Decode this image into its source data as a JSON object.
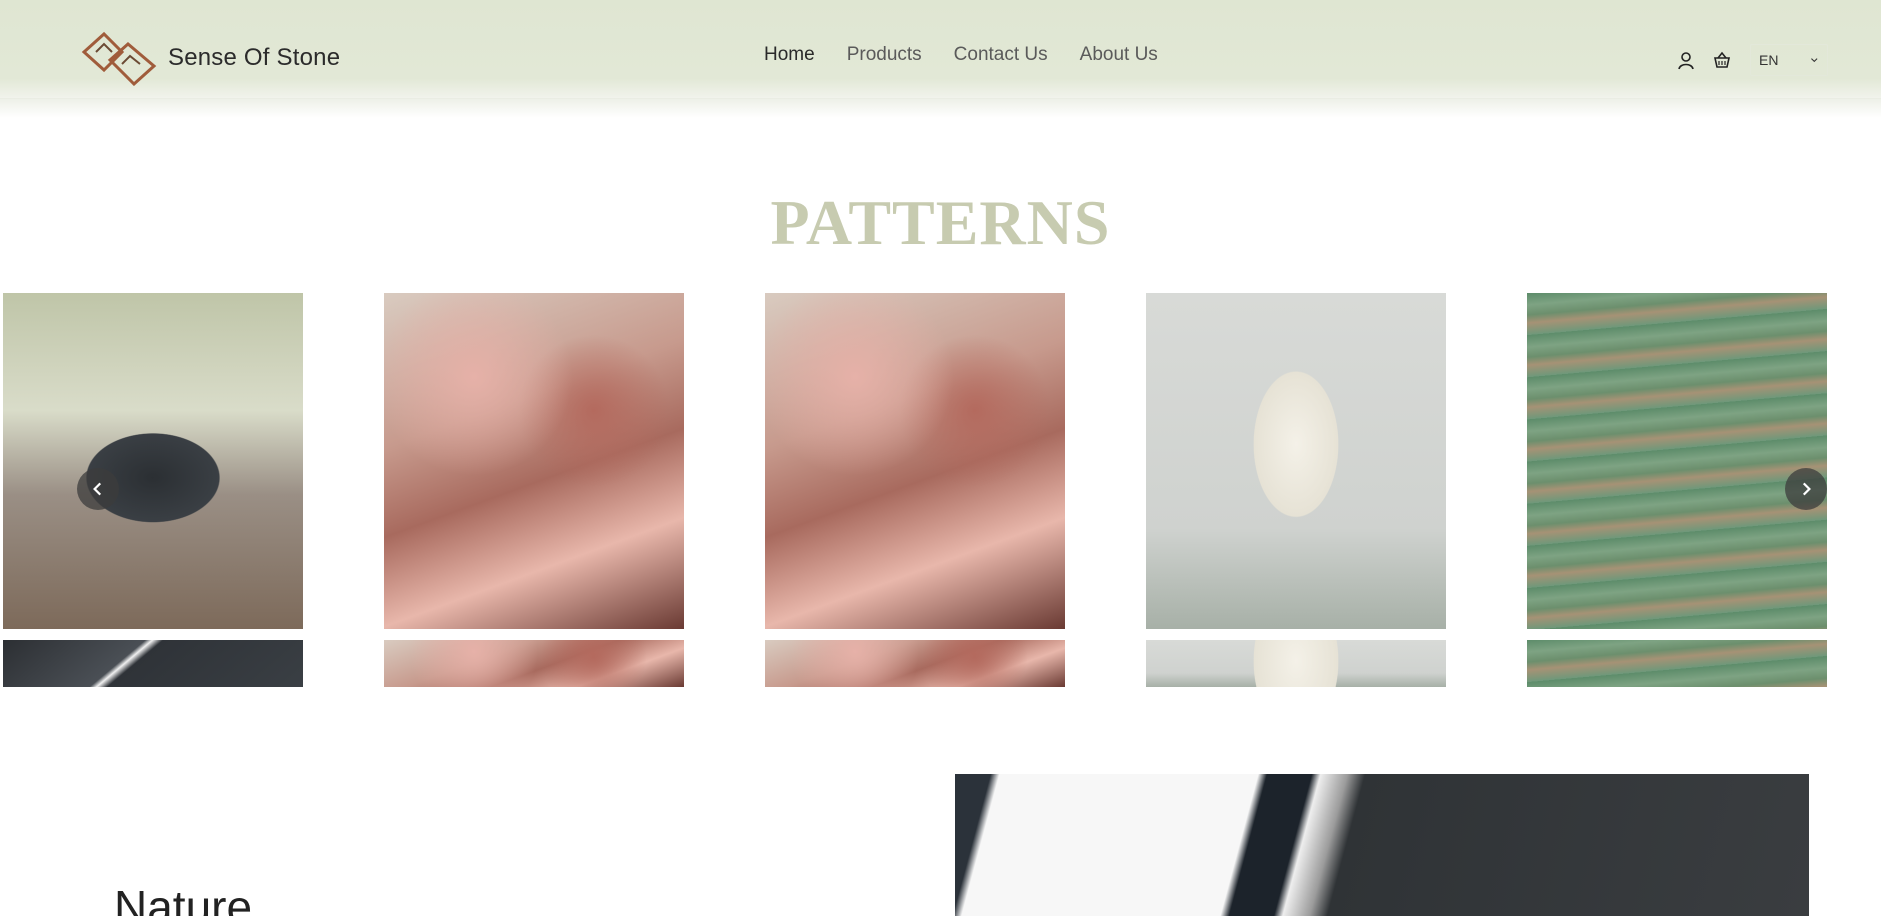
{
  "header": {
    "brand": "Sense Of Stone",
    "nav": [
      {
        "label": "Home",
        "active": true
      },
      {
        "label": "Products",
        "active": false
      },
      {
        "label": "Contact Us",
        "active": false
      },
      {
        "label": "About Us",
        "active": false
      }
    ],
    "language": "EN",
    "icons": [
      "user-icon",
      "basket-icon",
      "chevron-down-icon"
    ]
  },
  "patterns": {
    "title": "PATTERNS",
    "cards": [
      {
        "name": "dining-table",
        "image": "marble dining table"
      },
      {
        "name": "red-marble-1",
        "image": "red marble table top"
      },
      {
        "name": "red-marble-2",
        "image": "red marble table top"
      },
      {
        "name": "onyx-vase",
        "image": "white onyx vase"
      },
      {
        "name": "green-onyx",
        "image": "green onyx bowl"
      }
    ]
  },
  "feature": {
    "title": "Nature"
  },
  "colors": {
    "header_bg": "#dfe6d2",
    "section_title": "#c7cbb0",
    "logo": "#a05c3b"
  }
}
